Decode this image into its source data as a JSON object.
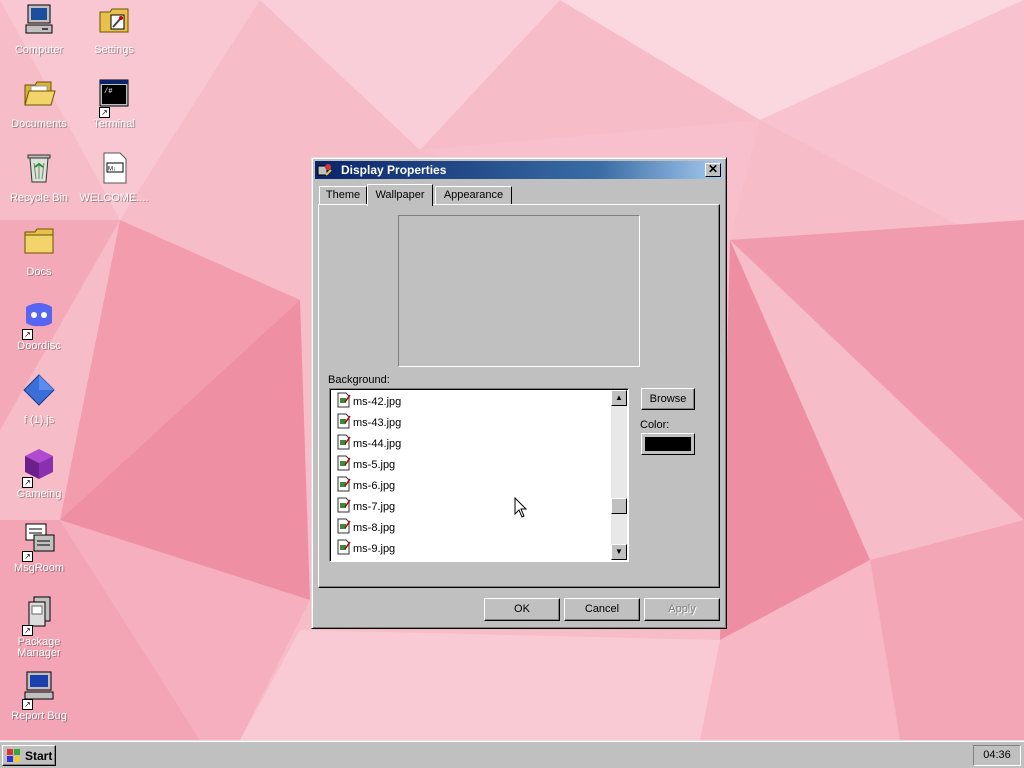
{
  "desktop": {
    "icons": [
      {
        "label": "Computer"
      },
      {
        "label": "Settings"
      },
      {
        "label": "Documents"
      },
      {
        "label": "Terminal"
      },
      {
        "label": "Recycle Bin"
      },
      {
        "label": "WELCOME...."
      },
      {
        "label": "Docs"
      },
      {
        "label": "Doordisc"
      },
      {
        "label": "f (1).js"
      },
      {
        "label": "Gameing"
      },
      {
        "label": "MsgRoom"
      },
      {
        "label": "Package Manager"
      },
      {
        "label": "Report Bug"
      }
    ]
  },
  "dialog": {
    "title": "Display Properties",
    "close_glyph": "✕",
    "tabs": [
      {
        "label": "Theme"
      },
      {
        "label": "Wallpaper"
      },
      {
        "label": "Appearance"
      }
    ],
    "active_tab": "Wallpaper",
    "background_label": "Background:",
    "files": [
      "ms-42.jpg",
      "ms-43.jpg",
      "ms-44.jpg",
      "ms-5.jpg",
      "ms-6.jpg",
      "ms-7.jpg",
      "ms-8.jpg",
      "ms-9.jpg"
    ],
    "browse_label": "Browse",
    "color_label": "Color:",
    "color_value": "#000000",
    "ok_label": "OK",
    "cancel_label": "Cancel",
    "apply_label": "Apply"
  },
  "taskbar": {
    "start_label": "Start",
    "clock": "04:36"
  }
}
